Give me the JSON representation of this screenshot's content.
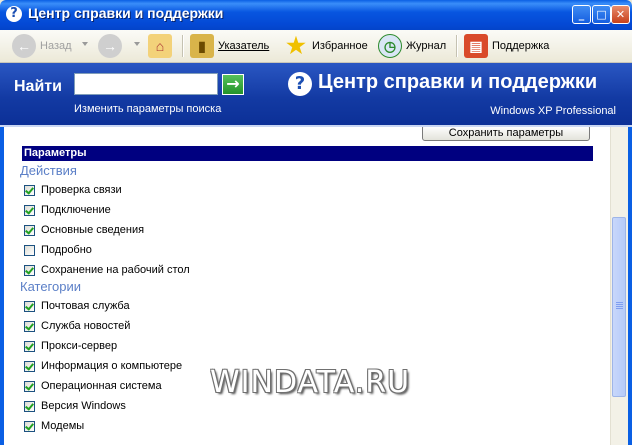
{
  "window": {
    "title": "Центр справки и поддержки",
    "minimize": "_",
    "maximize": "□",
    "close": "✕"
  },
  "toolbar": {
    "back_label": "Назад",
    "forward_label": "",
    "index_label": "Указатель",
    "favorites_label": "Избранное",
    "history_label": "Журнал",
    "support_label": "Поддержка"
  },
  "search": {
    "label": "Найти",
    "value": "",
    "go": "→",
    "options_link": "Изменить параметры поиска"
  },
  "header": {
    "help_icon": "?",
    "title": "Центр справки и поддержки",
    "os_name": "Windows XP Professional"
  },
  "content": {
    "save_button": "Сохранить параметры",
    "params_heading": "Параметры",
    "actions_title": "Действия",
    "actions": [
      {
        "label": "Проверка связи",
        "checked": true
      },
      {
        "label": "Подключение",
        "checked": true
      },
      {
        "label": "Основные сведения",
        "checked": true
      },
      {
        "label": "Подробно",
        "checked": false
      },
      {
        "label": "Сохранение на рабочий стол",
        "checked": true
      }
    ],
    "categories_title": "Категории",
    "categories": [
      {
        "label": "Почтовая служба",
        "checked": true
      },
      {
        "label": "Служба новостей",
        "checked": true
      },
      {
        "label": "Прокси-сервер",
        "checked": true
      },
      {
        "label": "Информация о компьютере",
        "checked": true
      },
      {
        "label": "Операционная система",
        "checked": true
      },
      {
        "label": "Версия Windows",
        "checked": true
      },
      {
        "label": "Модемы",
        "checked": true
      }
    ]
  },
  "watermark": "WINDATA.RU"
}
